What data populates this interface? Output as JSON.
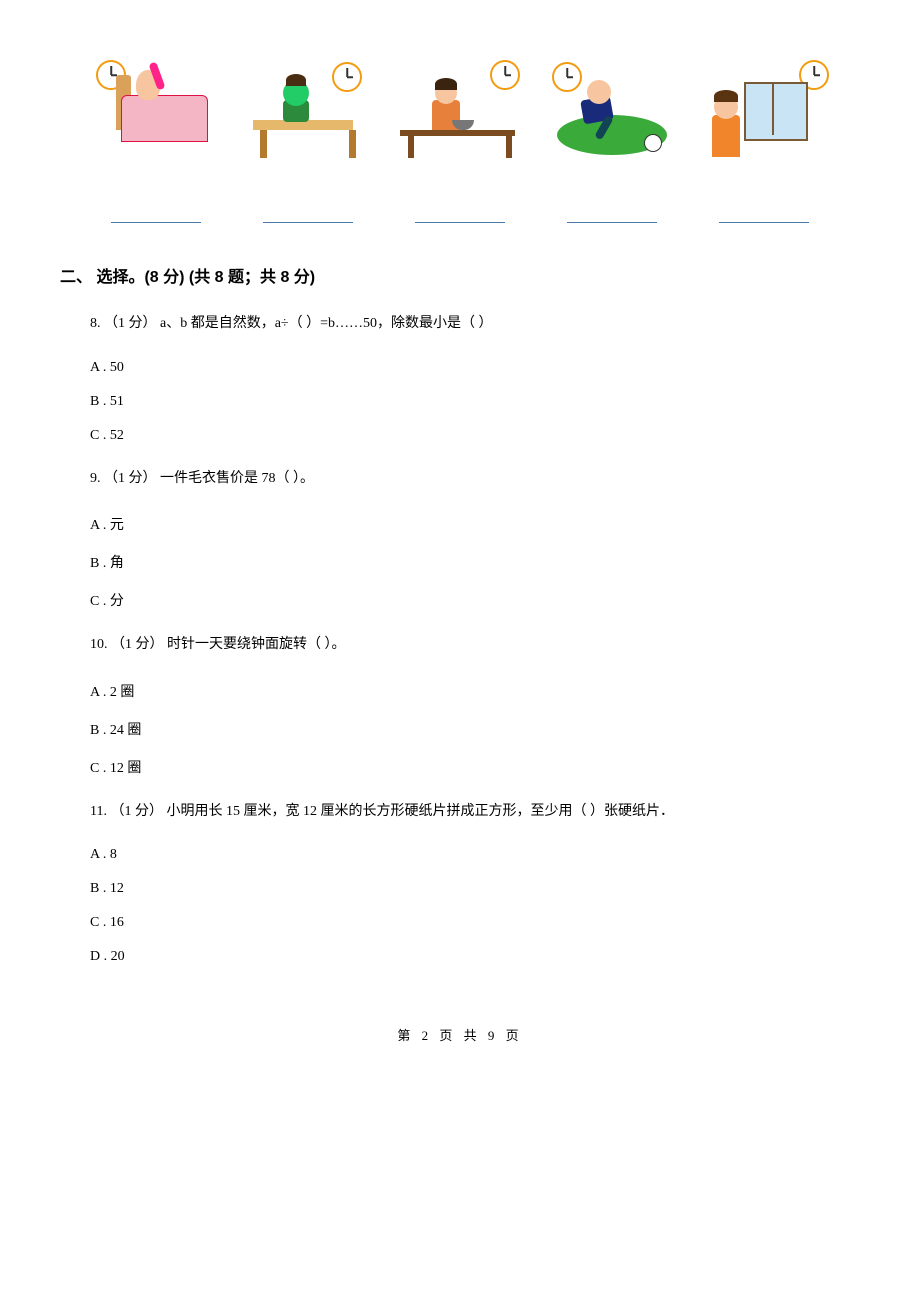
{
  "section": {
    "title": "二、 选择。(8 分)   (共 8 题；共 8 分)"
  },
  "q8": {
    "text": "8.  （1 分）  a、b 都是自然数，a÷（    ）=b……50，除数最小是（    ）",
    "A": "A .  50",
    "B": "B .  51",
    "C": "C .  52"
  },
  "q9": {
    "text": "9.  （1 分）  一件毛衣售价是 78（    ）。",
    "A": "A .  元",
    "B": "B .  角",
    "C": "C .  分"
  },
  "q10": {
    "text": "10.  （1 分）  时针一天要绕钟面旋转（    ）。",
    "A": "A .  2 圈",
    "B": "B .  24 圈",
    "C": "C .  12 圈"
  },
  "q11": {
    "text": "11.  （1 分）  小明用长 15 厘米，宽 12 厘米的长方形硬纸片拼成正方形，至少用（    ）张硬纸片．",
    "A": "A .  8",
    "B": "B .  12",
    "C": "C .  16",
    "D": "D .  20"
  },
  "footer": "第 2 页 共 9 页"
}
